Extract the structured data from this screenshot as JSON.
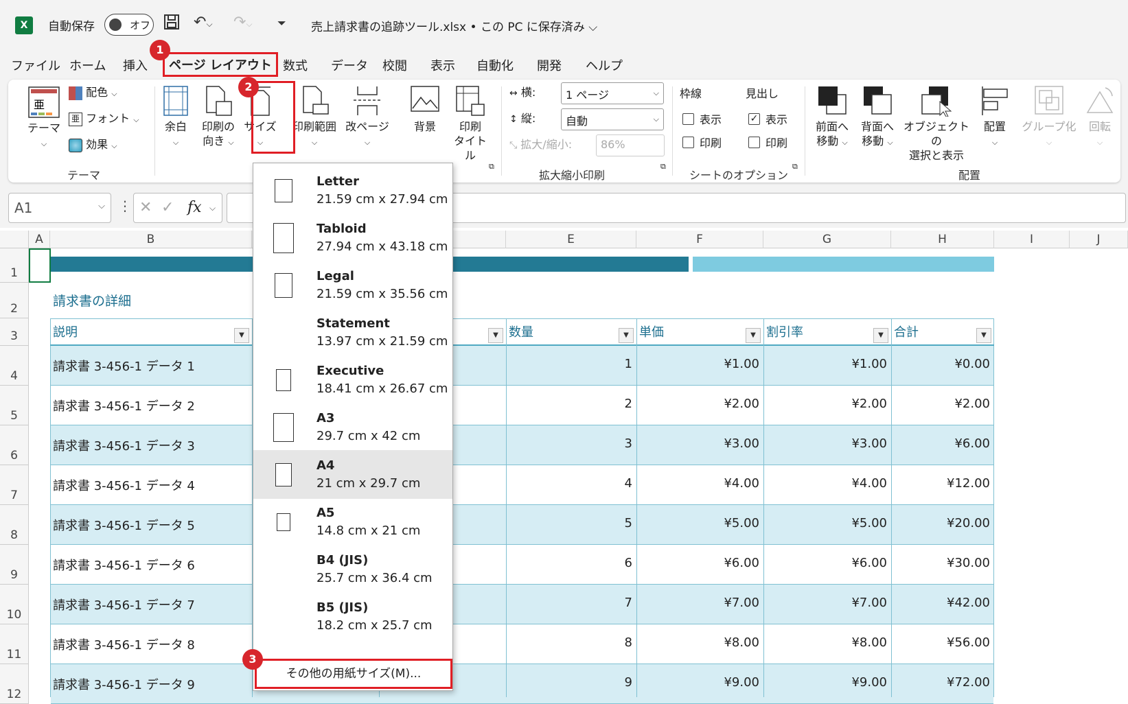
{
  "titlebar": {
    "app_logo": "X",
    "autosave_label": "自動保存",
    "autosave_state": "オフ",
    "doc_title": "売上請求書の追跡ツール.xlsx • この PC に保存済み ⌵"
  },
  "tabs": [
    "ファイル",
    "ホーム",
    "挿入",
    "ページ レイアウト",
    "数式",
    "データ",
    "校閲",
    "表示",
    "自動化",
    "開発",
    "ヘルプ"
  ],
  "badges": [
    "1",
    "2",
    "3"
  ],
  "ribbon": {
    "themes": {
      "theme": "テーマ",
      "colors": "配色",
      "fonts": "フォント",
      "effects": "効果",
      "group": "テーマ"
    },
    "page_setup": {
      "margins": "余白",
      "orientation_1": "印刷の",
      "orientation_2": "向き",
      "size": "サイズ",
      "print_area": "印刷範囲",
      "breaks": "改ページ",
      "background": "背景",
      "print_titles_1": "印刷",
      "print_titles_2": "タイトル"
    },
    "scale": {
      "width_label": "横:",
      "width_value": "1 ページ",
      "height_label": "縦:",
      "height_value": "自動",
      "scale_label": "拡大/縮小:",
      "scale_value": "86%",
      "group": "拡大縮小印刷"
    },
    "sheet_options": {
      "gridlines": "枠線",
      "headings": "見出し",
      "view": "表示",
      "print": "印刷",
      "group": "シートのオプション"
    },
    "arrange": {
      "bring_forward_1": "前面へ",
      "bring_forward_2": "移動",
      "send_backward_1": "背面へ",
      "send_backward_2": "移動",
      "selection_pane_1": "オブジェクトの",
      "selection_pane_2": "選択と表示",
      "align": "配置",
      "group_btn": "グループ化",
      "rotate": "回転",
      "group": "配置"
    }
  },
  "formula_bar": {
    "name_box": "A1",
    "fx": "fx"
  },
  "columns": [
    "A",
    "B",
    "C",
    "D",
    "E",
    "F",
    "G",
    "H",
    "I",
    "J"
  ],
  "rows": [
    "1",
    "2",
    "3",
    "4",
    "5",
    "6",
    "7",
    "8",
    "9",
    "10",
    "11",
    "12"
  ],
  "sheet": {
    "subtitle": "請求書の詳細",
    "headers": [
      "説明",
      "数量",
      "単価",
      "割引率",
      "合計"
    ],
    "data": [
      {
        "desc": "請求書 3-456-1 データ 1",
        "qty": "1",
        "price": "¥1.00",
        "disc": "¥1.00",
        "total": "¥0.00"
      },
      {
        "desc": "請求書 3-456-1 データ 2",
        "qty": "2",
        "price": "¥2.00",
        "disc": "¥2.00",
        "total": "¥2.00"
      },
      {
        "desc": "請求書 3-456-1 データ 3",
        "qty": "3",
        "price": "¥3.00",
        "disc": "¥3.00",
        "total": "¥6.00"
      },
      {
        "desc": "請求書 3-456-1 データ 4",
        "qty": "4",
        "price": "¥4.00",
        "disc": "¥4.00",
        "total": "¥12.00"
      },
      {
        "desc": "請求書 3-456-1 データ 5",
        "qty": "5",
        "price": "¥5.00",
        "disc": "¥5.00",
        "total": "¥20.00"
      },
      {
        "desc": "請求書 3-456-1 データ 6",
        "qty": "6",
        "price": "¥6.00",
        "disc": "¥6.00",
        "total": "¥30.00"
      },
      {
        "desc": "請求書 3-456-1 データ 7",
        "qty": "7",
        "price": "¥7.00",
        "disc": "¥7.00",
        "total": "¥42.00"
      },
      {
        "desc": "請求書 3-456-1 データ 8",
        "qty": "8",
        "price": "¥8.00",
        "disc": "¥8.00",
        "total": "¥56.00"
      },
      {
        "desc": "請求書 3-456-1 データ 9",
        "qty": "9",
        "price": "¥9.00",
        "disc": "¥9.00",
        "total": "¥72.00"
      }
    ]
  },
  "size_menu": {
    "items": [
      {
        "name": "Letter",
        "dims": "21.59 cm x 27.94 cm"
      },
      {
        "name": "Tabloid",
        "dims": "27.94 cm x 43.18 cm"
      },
      {
        "name": "Legal",
        "dims": "21.59 cm x 35.56 cm"
      },
      {
        "name": "Statement",
        "dims": "13.97 cm x 21.59 cm"
      },
      {
        "name": "Executive",
        "dims": "18.41 cm x 26.67 cm"
      },
      {
        "name": "A3",
        "dims": "29.7 cm x 42 cm"
      },
      {
        "name": "A4",
        "dims": "21 cm x 29.7 cm"
      },
      {
        "name": "A5",
        "dims": "14.8 cm x 21 cm"
      },
      {
        "name": "B4 (JIS)",
        "dims": "25.7 cm x 36.4 cm"
      },
      {
        "name": "B5 (JIS)",
        "dims": "18.2 cm x 25.7 cm"
      }
    ],
    "selected": "A4",
    "more": "その他の用紙サイズ(M)..."
  },
  "colors": {
    "accent_red": "#e01e25",
    "badge": "#d7262c",
    "header_bar_dark": "#237a94",
    "header_bar_light": "#7ecbe0",
    "row_band": "#d6edf4",
    "excel_green": "#107c41"
  }
}
